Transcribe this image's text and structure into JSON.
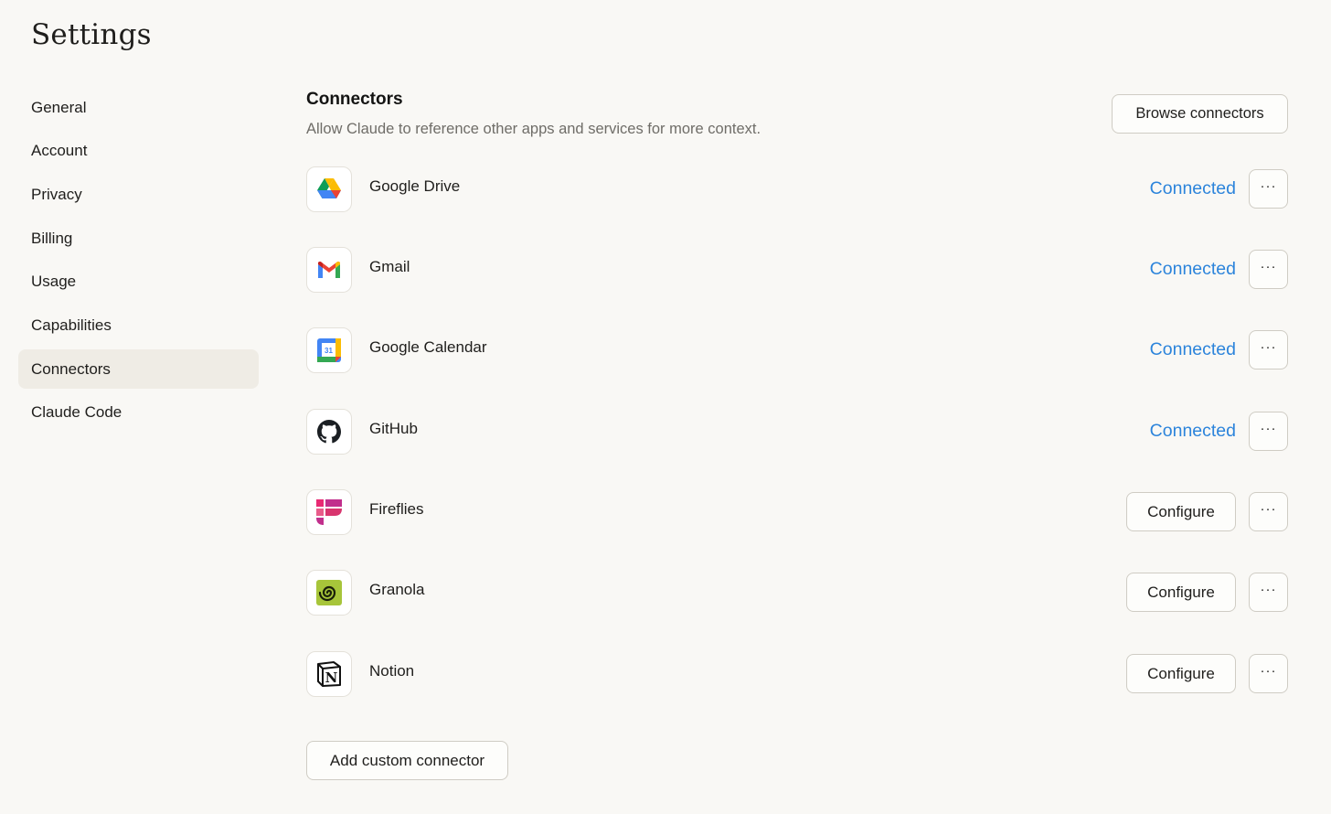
{
  "title": "Settings",
  "sidebar": {
    "items": [
      {
        "label": "General"
      },
      {
        "label": "Account"
      },
      {
        "label": "Privacy"
      },
      {
        "label": "Billing"
      },
      {
        "label": "Usage"
      },
      {
        "label": "Capabilities"
      },
      {
        "label": "Connectors",
        "active": true
      },
      {
        "label": "Claude Code"
      }
    ]
  },
  "connectors": {
    "title": "Connectors",
    "description": "Allow Claude to reference other apps and services for more context.",
    "browse_label": "Browse connectors",
    "more_label": "···",
    "items": [
      {
        "name": "Google Drive",
        "icon": "google-drive-icon",
        "status": "Connected"
      },
      {
        "name": "Gmail",
        "icon": "gmail-icon",
        "status": "Connected"
      },
      {
        "name": "Google Calendar",
        "icon": "google-calendar-icon",
        "status": "Connected",
        "icon_text": "31"
      },
      {
        "name": "GitHub",
        "icon": "github-icon",
        "status": "Connected"
      },
      {
        "name": "Fireflies",
        "icon": "fireflies-icon",
        "action": "Configure"
      },
      {
        "name": "Granola",
        "icon": "granola-icon",
        "action": "Configure"
      },
      {
        "name": "Notion",
        "icon": "notion-icon",
        "action": "Configure",
        "icon_text": "N"
      }
    ],
    "add_label": "Add custom connector"
  },
  "colors": {
    "background": "#f9f8f5",
    "active_nav": "#efece5",
    "connected_link": "#2c84db",
    "border": "#cfccc4"
  }
}
